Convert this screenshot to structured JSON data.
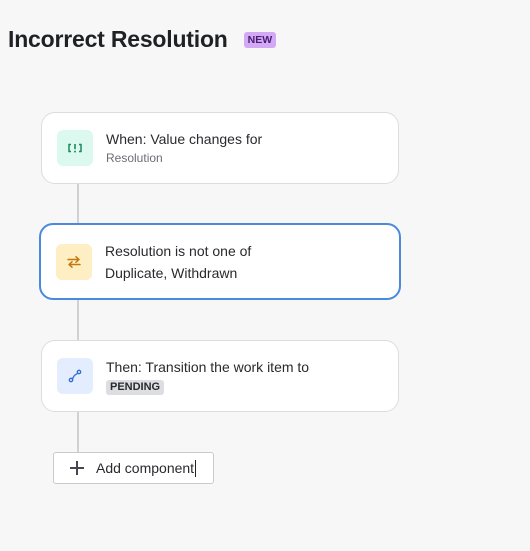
{
  "header": {
    "title": "Incorrect Resolution",
    "badge": "NEW"
  },
  "rule": {
    "trigger": {
      "icon": "trigger-icon",
      "title": "When: Value changes for",
      "detail": "Resolution"
    },
    "condition": {
      "icon": "condition-icon",
      "title": "Resolution is not one of",
      "detail": "Duplicate, Withdrawn"
    },
    "action": {
      "icon": "transition-icon",
      "title": "Then: Transition the work item to",
      "status": "PENDING"
    }
  },
  "add_component": {
    "label": "Add component"
  },
  "colors": {
    "accent": "#4a89dc",
    "badge": "#d3a8f5"
  }
}
